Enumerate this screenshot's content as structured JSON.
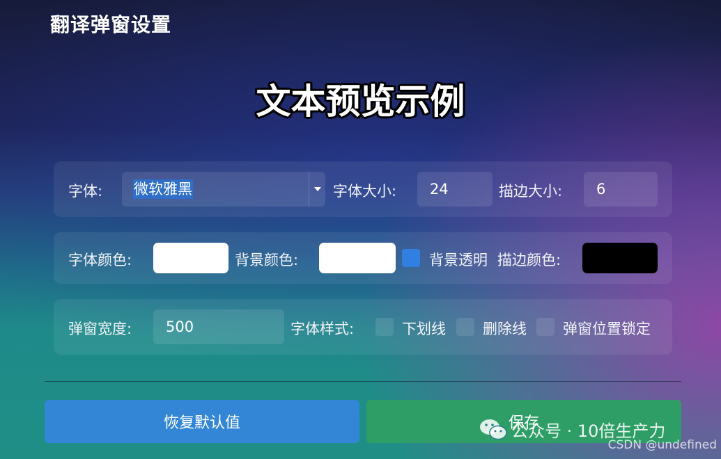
{
  "window": {
    "title": "翻译弹窗设置"
  },
  "preview": {
    "text": "文本预览示例"
  },
  "row1": {
    "font_label": "字体:",
    "font_value": "微软雅黑",
    "font_size_label": "字体大小:",
    "font_size_value": "24",
    "stroke_size_label": "描边大小:",
    "stroke_size_value": "6"
  },
  "row2": {
    "font_color_label": "字体颜色:",
    "font_color": "#ffffff",
    "bg_color_label": "背景颜色:",
    "bg_color": "#ffffff",
    "bg_transparent_label": "背景透明",
    "bg_transparent_checked": true,
    "stroke_color_label": "描边颜色:",
    "stroke_color": "#000000"
  },
  "row3": {
    "width_label": "弹窗宽度:",
    "width_value": "500",
    "style_label": "字体样式:",
    "underline_label": "下划线",
    "strikethrough_label": "删除线",
    "lock_label": "弹窗位置锁定"
  },
  "buttons": {
    "reset_label": "恢复默认值",
    "save_label": "保存"
  },
  "watermark": {
    "text": "公众号 · 10倍生产力",
    "csdn": "CSDN @undefined"
  },
  "colors": {
    "accent_blue": "#3386d6",
    "accent_green": "#2e9e66",
    "checkbox_on": "#2f80e0"
  }
}
